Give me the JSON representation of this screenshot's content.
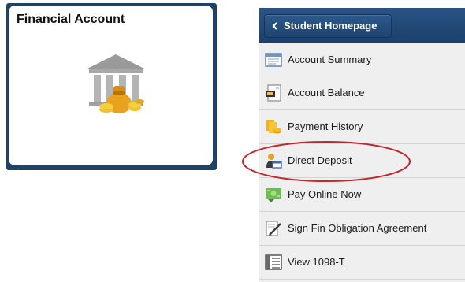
{
  "tile": {
    "title": "Financial Account",
    "icon": "bank-money-bag-icon"
  },
  "nav": {
    "back_label": "Student Homepage",
    "items": [
      {
        "label": "Account Summary",
        "icon": "account-summary-icon"
      },
      {
        "label": "Account Balance",
        "icon": "account-balance-icon"
      },
      {
        "label": "Payment History",
        "icon": "payment-history-icon"
      },
      {
        "label": "Direct Deposit",
        "icon": "direct-deposit-icon"
      },
      {
        "label": "Pay Online Now",
        "icon": "pay-online-icon"
      },
      {
        "label": "Sign Fin Obligation Agreement",
        "icon": "sign-agreement-icon"
      },
      {
        "label": "View 1098-T",
        "icon": "view-form-icon"
      }
    ]
  },
  "annotation": {
    "highlighted_item": "Direct Deposit",
    "color": "#c0282d"
  },
  "colors": {
    "tile_border": "#1f4267",
    "back_bar": "#244d7b",
    "panel_bg": "#efefef"
  }
}
